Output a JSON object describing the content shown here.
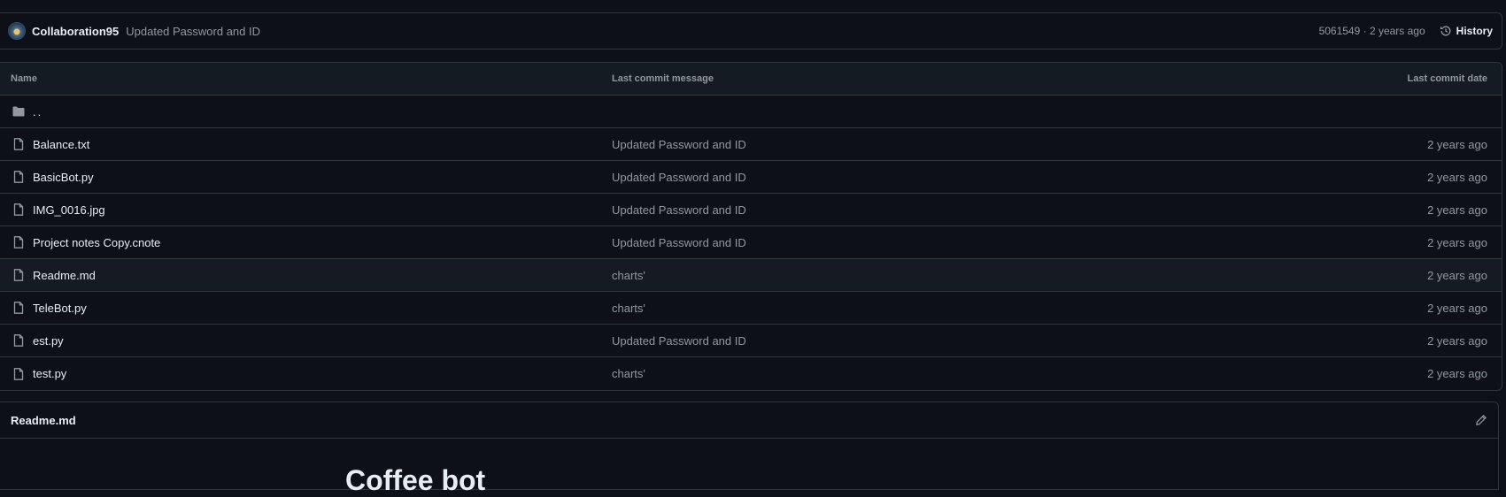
{
  "commit": {
    "author": "Collaboration95",
    "message": "Updated Password and ID",
    "meta": "5061549 · 2 years ago",
    "history_label": "History"
  },
  "table": {
    "headers": {
      "name": "Name",
      "message": "Last commit message",
      "date": "Last commit date"
    },
    "parent_dir": "..",
    "rows": [
      {
        "name": "Balance.txt",
        "message": "Updated Password and ID",
        "date": "2 years ago"
      },
      {
        "name": "BasicBot.py",
        "message": "Updated Password and ID",
        "date": "2 years ago"
      },
      {
        "name": "IMG_0016.jpg",
        "message": "Updated Password and ID",
        "date": "2 years ago"
      },
      {
        "name": "Project notes Copy.cnote",
        "message": "Updated Password and ID",
        "date": "2 years ago"
      },
      {
        "name": "Readme.md",
        "message": "charts'",
        "date": "2 years ago"
      },
      {
        "name": "TeleBot.py",
        "message": "charts'",
        "date": "2 years ago"
      },
      {
        "name": "est.py",
        "message": "Updated Password and ID",
        "date": "2 years ago"
      },
      {
        "name": "test.py",
        "message": "charts'",
        "date": "2 years ago"
      }
    ]
  },
  "readme": {
    "title": "Readme.md",
    "heading": "Coffee bot"
  },
  "icons": {
    "folder": "folder-icon",
    "file": "file-icon",
    "history": "history-icon",
    "edit": "pencil-icon"
  }
}
